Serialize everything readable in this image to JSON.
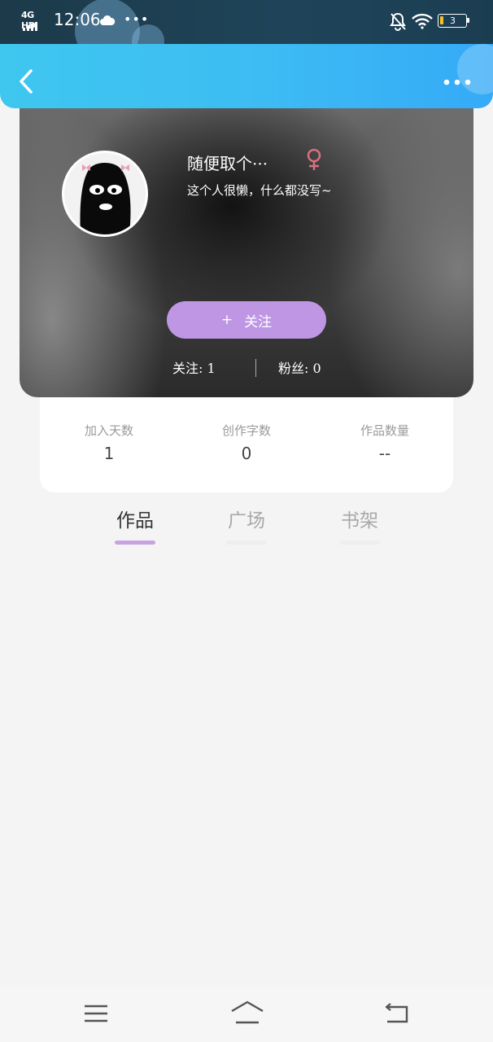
{
  "status_bar": {
    "network": "4G HD",
    "time": "12:06",
    "more": "•••",
    "battery_level": "3",
    "battery_color": "#f3c321"
  },
  "header": {
    "back_icon": "chevron-left-icon",
    "more_icon": "more-dots-icon",
    "gradient_start": "#3fc7ef",
    "gradient_end": "#35aaf7"
  },
  "profile": {
    "username": "随便取个···",
    "gender_icon": "female-icon",
    "gender_color": "#d9717f",
    "bio": "这个人很懒，什么都没写~",
    "follow_button": {
      "plus": "+",
      "label": "关注",
      "color": "#be96e4"
    },
    "following_label": "关注: 1",
    "fans_label": "粉丝: 0"
  },
  "stats": [
    {
      "label": "加入天数",
      "value": "1"
    },
    {
      "label": "创作字数",
      "value": "0"
    },
    {
      "label": "作品数量",
      "value": "--"
    }
  ],
  "tabs": [
    {
      "label": "作品",
      "active": true
    },
    {
      "label": "广场",
      "active": false
    },
    {
      "label": "书架",
      "active": false
    }
  ],
  "bottom_nav": {
    "icons": [
      "menu-icon",
      "home-icon",
      "back-icon"
    ]
  }
}
